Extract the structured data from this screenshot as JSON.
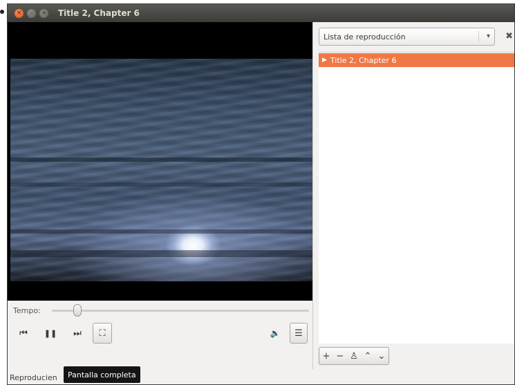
{
  "window": {
    "title": "Title 2, Chapter 6",
    "close_glyph": "×",
    "min_glyph": "–",
    "max_glyph": "+"
  },
  "controls": {
    "tempo_label": "Tempo:",
    "tempo_position": 0.1,
    "prev_glyph": "⏮",
    "pause_glyph": "❚❚",
    "next_glyph": "⏭",
    "fullscreen_glyph": "⛶",
    "volume_glyph": "🔉",
    "sidebar_glyph": "☰",
    "icons": [
      "skip-back-icon",
      "pause-icon",
      "skip-forward-icon",
      "fullscreen-icon",
      "volume-icon",
      "sidebar-toggle-icon"
    ]
  },
  "status": {
    "text": "Reproducien",
    "tooltip": "Pantalla completa"
  },
  "sidebar": {
    "combo_label": "Lista de reproducción",
    "combo_arrow": "▾",
    "close_glyph": "✖",
    "playlist": [
      {
        "label": "Title 2, Chapter 6",
        "selected": true,
        "marker": "▶"
      }
    ],
    "tools": {
      "add": "+",
      "remove": "−",
      "save": "♙",
      "up": "⌃",
      "down": "⌄"
    }
  },
  "colors": {
    "selection": "#f07746",
    "titlebar": "#3c3b37",
    "window_bg": "#f2f1f0"
  }
}
